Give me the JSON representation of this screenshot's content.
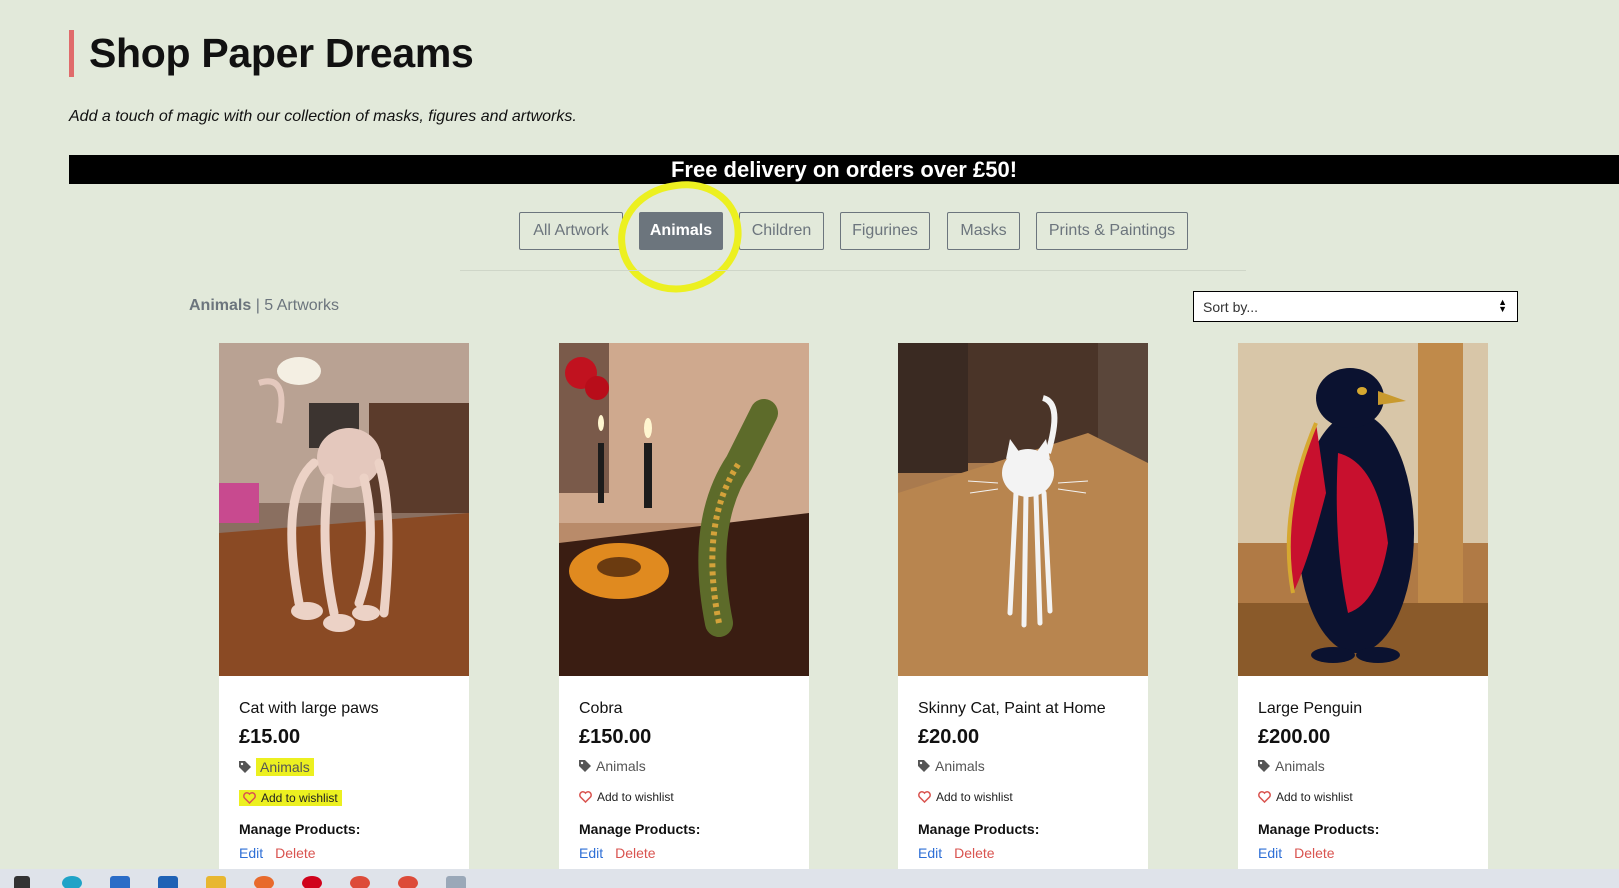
{
  "header": {
    "title": "Shop Paper Dreams",
    "tagline": "Add a touch of magic with our collection of masks, figures and artworks."
  },
  "banner": {
    "text": "Free delivery on orders over £50!"
  },
  "filters": [
    {
      "label": "All Artwork",
      "active": false
    },
    {
      "label": "Animals",
      "active": true
    },
    {
      "label": "Children",
      "active": false
    },
    {
      "label": "Figurines",
      "active": false
    },
    {
      "label": "Masks",
      "active": false
    },
    {
      "label": "Prints & Paintings",
      "active": false
    }
  ],
  "results": {
    "category": "Animals",
    "separator": " | ",
    "count": "5 Artworks"
  },
  "sort": {
    "placeholder": "Sort by..."
  },
  "products": [
    {
      "name": "Cat with large paws",
      "price": "£15.00",
      "category": "Animals",
      "wishlist": "Add to wishlist",
      "manage": "Manage Products:",
      "edit": "Edit",
      "delete": "Delete"
    },
    {
      "name": "Cobra",
      "price": "£150.00",
      "category": "Animals",
      "wishlist": "Add to wishlist",
      "manage": "Manage Products:",
      "edit": "Edit",
      "delete": "Delete"
    },
    {
      "name": "Skinny Cat, Paint at Home",
      "price": "£20.00",
      "category": "Animals",
      "wishlist": "Add to wishlist",
      "manage": "Manage Products:",
      "edit": "Edit",
      "delete": "Delete"
    },
    {
      "name": "Large Penguin",
      "price": "£200.00",
      "category": "Animals",
      "wishlist": "Add to wishlist",
      "manage": "Manage Products:",
      "edit": "Edit",
      "delete": "Delete"
    }
  ],
  "colors": {
    "background": "#e2e9da",
    "accent_bar": "#e06b6b",
    "active_filter": "#6c757d",
    "edit_link": "#2e6fd6",
    "delete_link": "#d9534f",
    "annotation_highlight": "#ecf020"
  },
  "icons": [
    "tag-icon",
    "heart-icon",
    "sort-arrows-icon"
  ]
}
